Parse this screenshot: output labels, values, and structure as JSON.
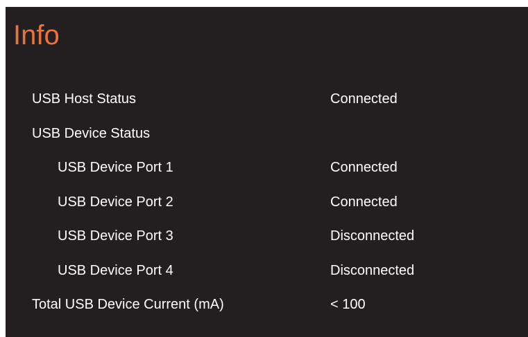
{
  "colors": {
    "background": "#231f20",
    "title": "#e8743b",
    "text": "#ffffff"
  },
  "page": {
    "title": "Info"
  },
  "status": {
    "host_label": "USB Host Status",
    "host_value": "Connected",
    "device_label": "USB Device Status",
    "ports": [
      {
        "label": "USB Device Port 1",
        "value": "Connected"
      },
      {
        "label": "USB Device Port 2",
        "value": "Connected"
      },
      {
        "label": "USB Device Port 3",
        "value": "Disconnected"
      },
      {
        "label": "USB Device Port 4",
        "value": "Disconnected"
      }
    ],
    "current_label": "Total USB Device Current (mA)",
    "current_value": "< 100"
  }
}
